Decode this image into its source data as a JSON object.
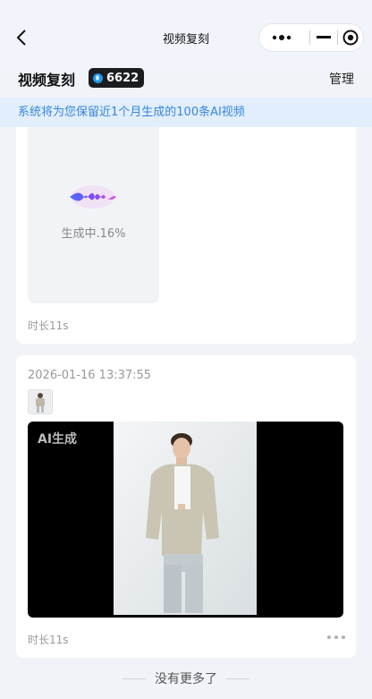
{
  "nav": {
    "title": "视频复刻",
    "back_icon": "chevron-left-icon",
    "capsule": {
      "more_icon": "more-dots-icon",
      "minimize_icon": "minus-icon",
      "close_icon": "target-circle-icon"
    }
  },
  "header": {
    "title": "视频复刻",
    "credits": "6622",
    "credit_icon": "coin-icon",
    "manage_label": "管理"
  },
  "notice": {
    "text": "系统将为您保留近1个月生成的100条AI视频"
  },
  "videos": [
    {
      "status": "生成中.16%",
      "duration": "时长11s",
      "icon": "audio-wave-icon"
    },
    {
      "timestamp": "2026-01-16 13:37:55",
      "badge": "AI生成",
      "duration": "时长11s",
      "more_icon": "more-dots-icon"
    }
  ],
  "footer": {
    "end_text": "没有更多了"
  },
  "colors": {
    "accent": "#3586e0",
    "notice_bg": "#e2eefb",
    "badge_bg": "#1c1d21",
    "coin": "#2196f3"
  }
}
